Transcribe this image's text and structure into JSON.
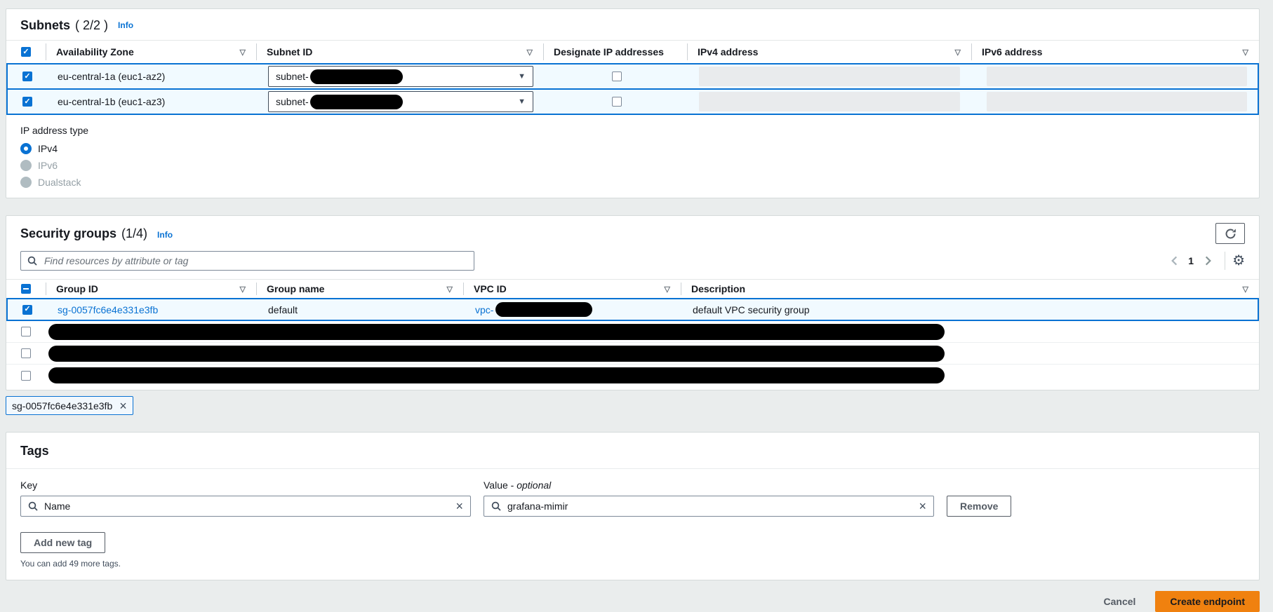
{
  "colors": {
    "page_bg": "#eaeded",
    "link_blue": "#0972d3",
    "selected_row_bg": "#f1faff",
    "selected_row_border": "#0972d3",
    "checkbox_blue": "#0972d3",
    "disabled_field_bg": "#e9ebed",
    "primary_button_bg": "#f0810f",
    "primary_button_text": "#16191f"
  },
  "icons": {
    "sort": "▽",
    "caret_down": "▼",
    "gear": "⚙",
    "clear": "×"
  },
  "subnets": {
    "title": "Subnets",
    "count": "( 2/2 )",
    "info_label": "Info",
    "columns": {
      "availability_zone": "Availability Zone",
      "subnet_id": "Subnet ID",
      "designate_ip": "Designate IP addresses",
      "ipv4": "IPv4 address",
      "ipv6": "IPv6 address"
    },
    "rows": [
      {
        "availability_zone": "eu-central-1a (euc1-az2)",
        "subnet_id_prefix": "subnet-",
        "selected": true,
        "subnet_id_redacted": true
      },
      {
        "availability_zone": "eu-central-1b (euc1-az3)",
        "subnet_id_prefix": "subnet-",
        "selected": true,
        "subnet_id_redacted": true
      }
    ],
    "ip_address_type": {
      "label": "IP address type",
      "options": [
        {
          "label": "IPv4",
          "state": "selected"
        },
        {
          "label": "IPv6",
          "state": "disabled"
        },
        {
          "label": "Dualstack",
          "state": "disabled"
        }
      ]
    }
  },
  "security_groups": {
    "title": "Security groups",
    "count": "(1/4)",
    "info_label": "Info",
    "filter_placeholder": "Find resources by attribute or tag",
    "pagination": {
      "current_page": "1"
    },
    "columns": {
      "group_id": "Group ID",
      "group_name": "Group name",
      "vpc_id": "VPC ID",
      "description": "Description"
    },
    "rows": [
      {
        "group_id": "sg-0057fc6e4e331e3fb",
        "group_name": "default",
        "vpc_id_prefix": "vpc-",
        "vpc_id_redacted": true,
        "description": "default VPC security group",
        "selected": true
      },
      {
        "redacted": true,
        "selected": false
      },
      {
        "redacted": true,
        "selected": false
      },
      {
        "redacted": true,
        "selected": false
      }
    ],
    "selected_token": "sg-0057fc6e4e331e3fb"
  },
  "tags": {
    "title": "Tags",
    "key": {
      "label": "Key",
      "value": "Name"
    },
    "value": {
      "label_prefix": "Value - ",
      "label_optional": "optional",
      "value": "grafana-mimir"
    },
    "remove_label": "Remove",
    "add_label": "Add new tag",
    "helper_text": "You can add 49 more tags."
  },
  "footer": {
    "cancel_label": "Cancel",
    "create_label": "Create endpoint"
  }
}
